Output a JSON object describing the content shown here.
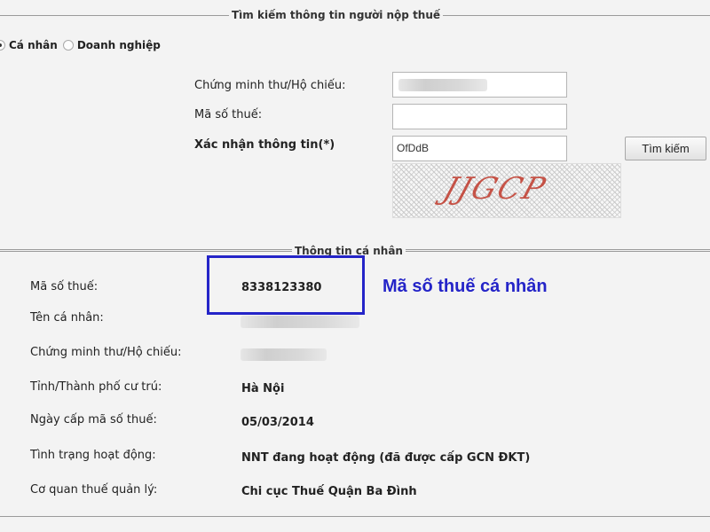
{
  "search_section": {
    "legend": "Tìm kiếm thông tin người nộp thuế",
    "radio_options": [
      {
        "label": "Cá nhân",
        "checked": true
      },
      {
        "label": "Doanh nghiệp",
        "checked": false
      }
    ],
    "fields": {
      "id_label": "Chứng minh thư/Hộ chiếu:",
      "tax_code_label": "Mã số thuế:",
      "captcha_label": "Xác nhận thông tin(*)",
      "captcha_value": "OfDdB"
    },
    "captcha_image_text": "JJGCP",
    "search_button": "Tìm kiếm"
  },
  "info_section": {
    "legend": "Thông tin cá nhân",
    "rows": [
      {
        "label": "Mã số thuế:",
        "value": "8338123380"
      },
      {
        "label": "Tên cá nhân:",
        "value": ""
      },
      {
        "label": "Chứng minh thư/Hộ chiếu:",
        "value": ""
      },
      {
        "label": "Tỉnh/Thành phố cư trú:",
        "value": "Hà Nội"
      },
      {
        "label": "Ngày cấp mã số thuế:",
        "value": "05/03/2014"
      },
      {
        "label": "Tình trạng hoạt động:",
        "value": "NNT đang hoạt động (đã được cấp GCN ĐKT)"
      },
      {
        "label": "Cơ quan thuế quản lý:",
        "value": "Chi cục Thuế Quận Ba Đình"
      }
    ],
    "annotation": "Mã số thuế cá nhân"
  },
  "colors": {
    "annotation": "#2424c8",
    "background": "#f3f3f3"
  }
}
